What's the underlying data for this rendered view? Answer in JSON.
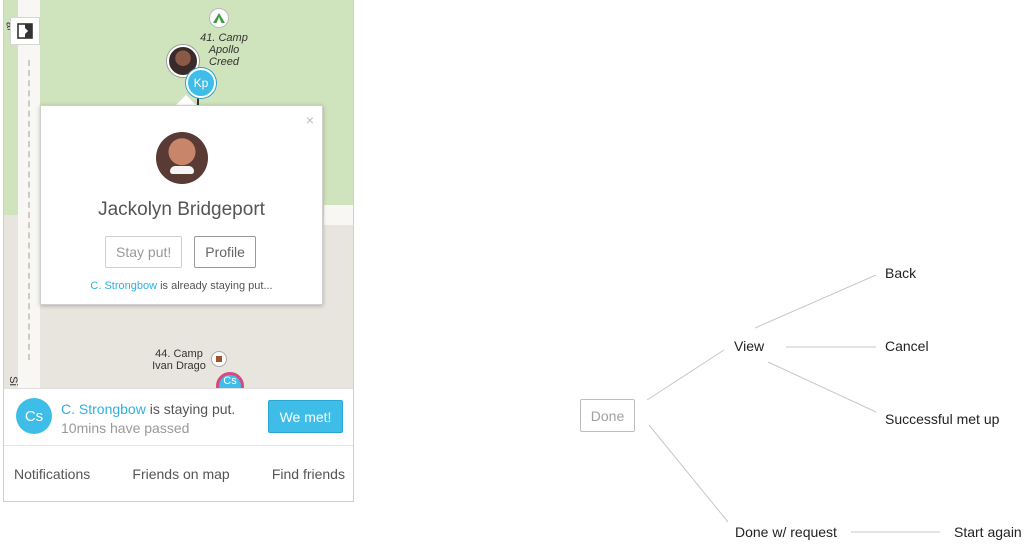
{
  "map": {
    "camp_label_top": "41. Camp\nApollo Creed",
    "camp_label_bottom": "44. Camp\nIvan Drago",
    "edge_label_top": "ai",
    "edge_label_bottom": "Si",
    "marker_kp": "Kp",
    "marker_cs": "Cs"
  },
  "popup": {
    "close": "×",
    "name": "Jackolyn Bridgeport",
    "stay_button": "Stay put!",
    "profile_button": "Profile",
    "status_link": "C. Strongbow",
    "status_text": " is already staying put..."
  },
  "notification": {
    "avatar": "Cs",
    "name_link": "C. Strongbow",
    "text": " is staying put.",
    "time": "10mins have passed",
    "met_button": "We met!"
  },
  "tabs": [
    "Notifications",
    "Friends on map",
    "Find friends"
  ],
  "flow": {
    "done": "Done",
    "view": "View",
    "back": "Back",
    "cancel": "Cancel",
    "successful": "Successful met up",
    "done_request": "Done w/ request",
    "start_again": "Start again"
  }
}
